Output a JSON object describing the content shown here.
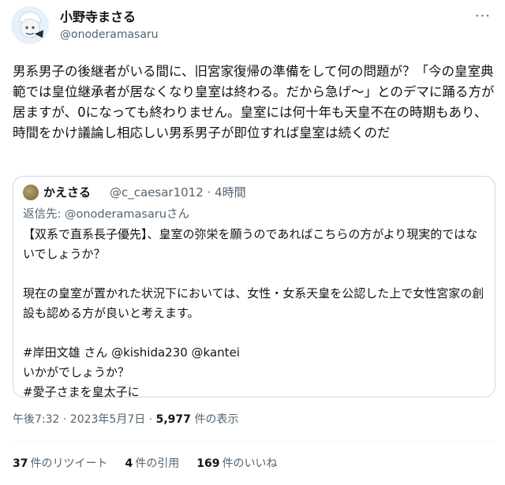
{
  "author": {
    "name": "小野寺まさる",
    "handle": "@onoderamasaru",
    "more_icon": "more-dots-icon"
  },
  "tweet": {
    "text": "男系男子の後継者がいる間に、旧宮家復帰の準備をして何の問題が？「今の皇室典範では皇位継承者が居なくなり皇室は終わる。だから急げ～」とのデマに踊る方が居ますが、0になっても終わりません。皇室には何十年も天皇不在の時期もあり、時間をかけ議論し相応しい男系男子が即位すれば皇室は続くのだ"
  },
  "quote": {
    "name": "かえさる",
    "handle_time": "@c_caesar1012 · 4時間",
    "reply_to": "返信先: @onoderamasaruさん",
    "text": "【双系で直系長子優先】、皇室の弥栄を願うのであればこちらの方がより現実的ではないでしょうか？\n\n現在の皇室が置かれた状況下においては、女性・女系天皇を公認した上で女性宮家の創設も認める方が良いと考えます。\n\n#岸田文雄 さん @kishida230 @kantei\nいかがでしょうか？\n#愛子さまを皇太子に"
  },
  "meta": {
    "time_date": "午後7:32 · 2023年5月7日 · ",
    "views_count": "5,977",
    "views_label": " 件の表示"
  },
  "stats": {
    "retweets_count": "37",
    "retweets_label": "件のリツイート",
    "quotes_count": "4",
    "quotes_label": "件の引用",
    "likes_count": "169",
    "likes_label": "件のいいね"
  }
}
